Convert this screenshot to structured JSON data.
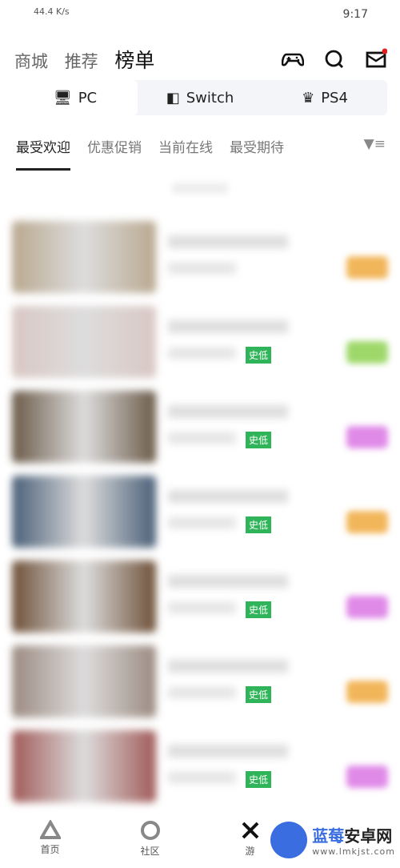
{
  "status": {
    "network": "44.4 K/s",
    "time": "9:17"
  },
  "nav": {
    "items": [
      "商城",
      "推荐",
      "榜单"
    ],
    "active": 2
  },
  "platforms": [
    "PC",
    "Switch",
    "PS4"
  ],
  "tabs": [
    "最受欢迎",
    "优惠促销",
    "当前在线",
    "最受期待"
  ],
  "badge_label": "史低",
  "rows": [
    {
      "badge": false,
      "tag_color": "#f2b65a",
      "thumb": "#b9a88f"
    },
    {
      "badge": true,
      "tag_color": "#9ed86a",
      "thumb": "#d9c7c3"
    },
    {
      "badge": true,
      "tag_color": "#e08ae8",
      "thumb": "#6b5a48"
    },
    {
      "badge": true,
      "tag_color": "#f2b65a",
      "thumb": "#4a5f78"
    },
    {
      "badge": true,
      "tag_color": "#e08ae8",
      "thumb": "#6e5038"
    },
    {
      "badge": true,
      "tag_color": "#f2b65a",
      "thumb": "#9b8a80"
    },
    {
      "badge": true,
      "tag_color": "#e08ae8",
      "thumb": "#a05a58"
    }
  ],
  "bottom": [
    "首页",
    "社区",
    "游"
  ],
  "watermark": {
    "name_a": "蓝莓",
    "name_b": "安卓网",
    "url": "www.lmkjst.com"
  }
}
